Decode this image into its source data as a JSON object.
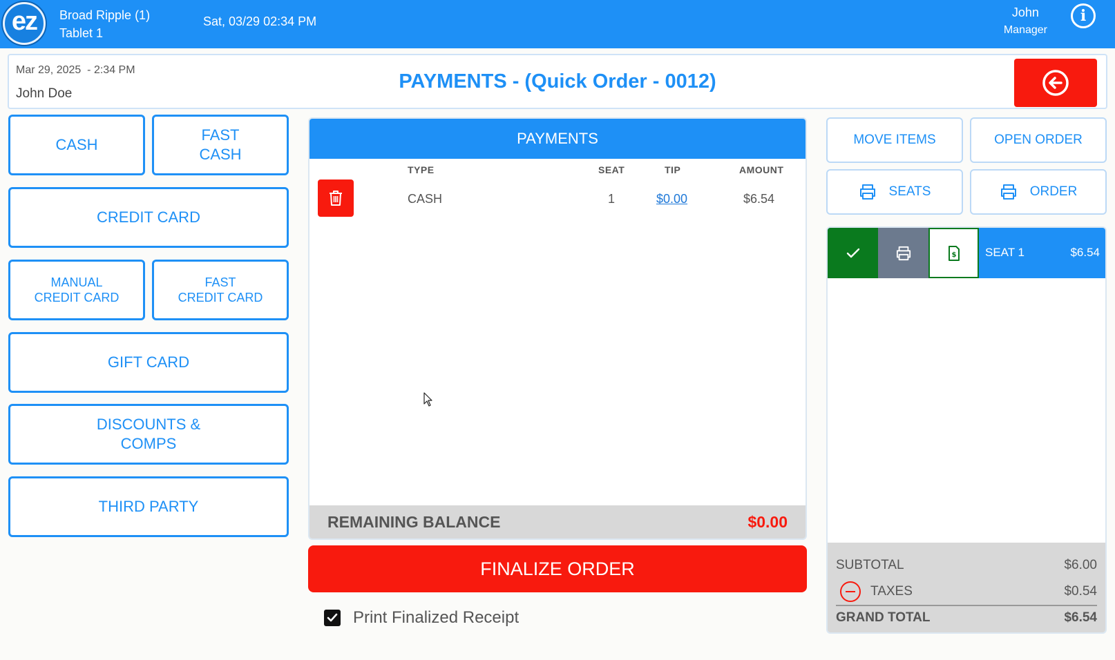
{
  "topbar": {
    "logo_text": "ez",
    "location": "Broad Ripple (1)",
    "device": "Tablet 1",
    "datetime": "Sat, 03/29 02:34 PM",
    "user_name": "John",
    "user_role": "Manager",
    "icons": {
      "info": "info-icon"
    }
  },
  "header": {
    "order_date": "Mar 29, 2025  - 2:34 PM",
    "customer": "John Doe",
    "title": "PAYMENTS - (Quick Order - 0012)",
    "icons": {
      "back": "arrow-left-circle-icon"
    },
    "back_color": "#f81a0e"
  },
  "payment_methods": {
    "cash": "CASH",
    "fast_cash": "FAST\nCASH",
    "credit_card": "CREDIT CARD",
    "manual_credit_card": "MANUAL\nCREDIT CARD",
    "fast_credit_card": "FAST\nCREDIT CARD",
    "gift_card": "GIFT CARD",
    "discounts_comps": "DISCOUNTS &\nCOMPS",
    "third_party": "THIRD PARTY"
  },
  "payments": {
    "header": "PAYMENTS",
    "columns": {
      "type": "TYPE",
      "seat": "SEAT",
      "tip": "TIP",
      "amount": "AMOUNT"
    },
    "rows": [
      {
        "type": "CASH",
        "seat": "1",
        "tip": "$0.00",
        "amount": "$6.54",
        "delete_icon": "trash-icon"
      }
    ],
    "remaining_label": "REMAINING BALANCE",
    "remaining_value": "$0.00"
  },
  "finalize": {
    "label": "FINALIZE ORDER"
  },
  "print_receipt": {
    "label": "Print Finalized Receipt",
    "checked": true
  },
  "actions": {
    "move_items": "MOVE ITEMS",
    "open_order": "OPEN ORDER",
    "print_seats": "SEATS",
    "print_order": "ORDER",
    "icons": {
      "printer": "printer-icon"
    }
  },
  "seats": [
    {
      "label": "SEAT 1",
      "amount": "$6.54",
      "icons": [
        "check-icon",
        "printer-icon",
        "receipt-icon"
      ]
    }
  ],
  "totals": {
    "subtotal_label": "SUBTOTAL",
    "subtotal": "$6.00",
    "taxes_label": "TAXES",
    "taxes": "$0.54",
    "grand_total_label": "GRAND TOTAL",
    "grand_total": "$6.54"
  },
  "colors": {
    "primary": "#1e90f6",
    "danger": "#f81a0e",
    "success": "#0a7a1e",
    "muted": "#6c7a8e"
  }
}
